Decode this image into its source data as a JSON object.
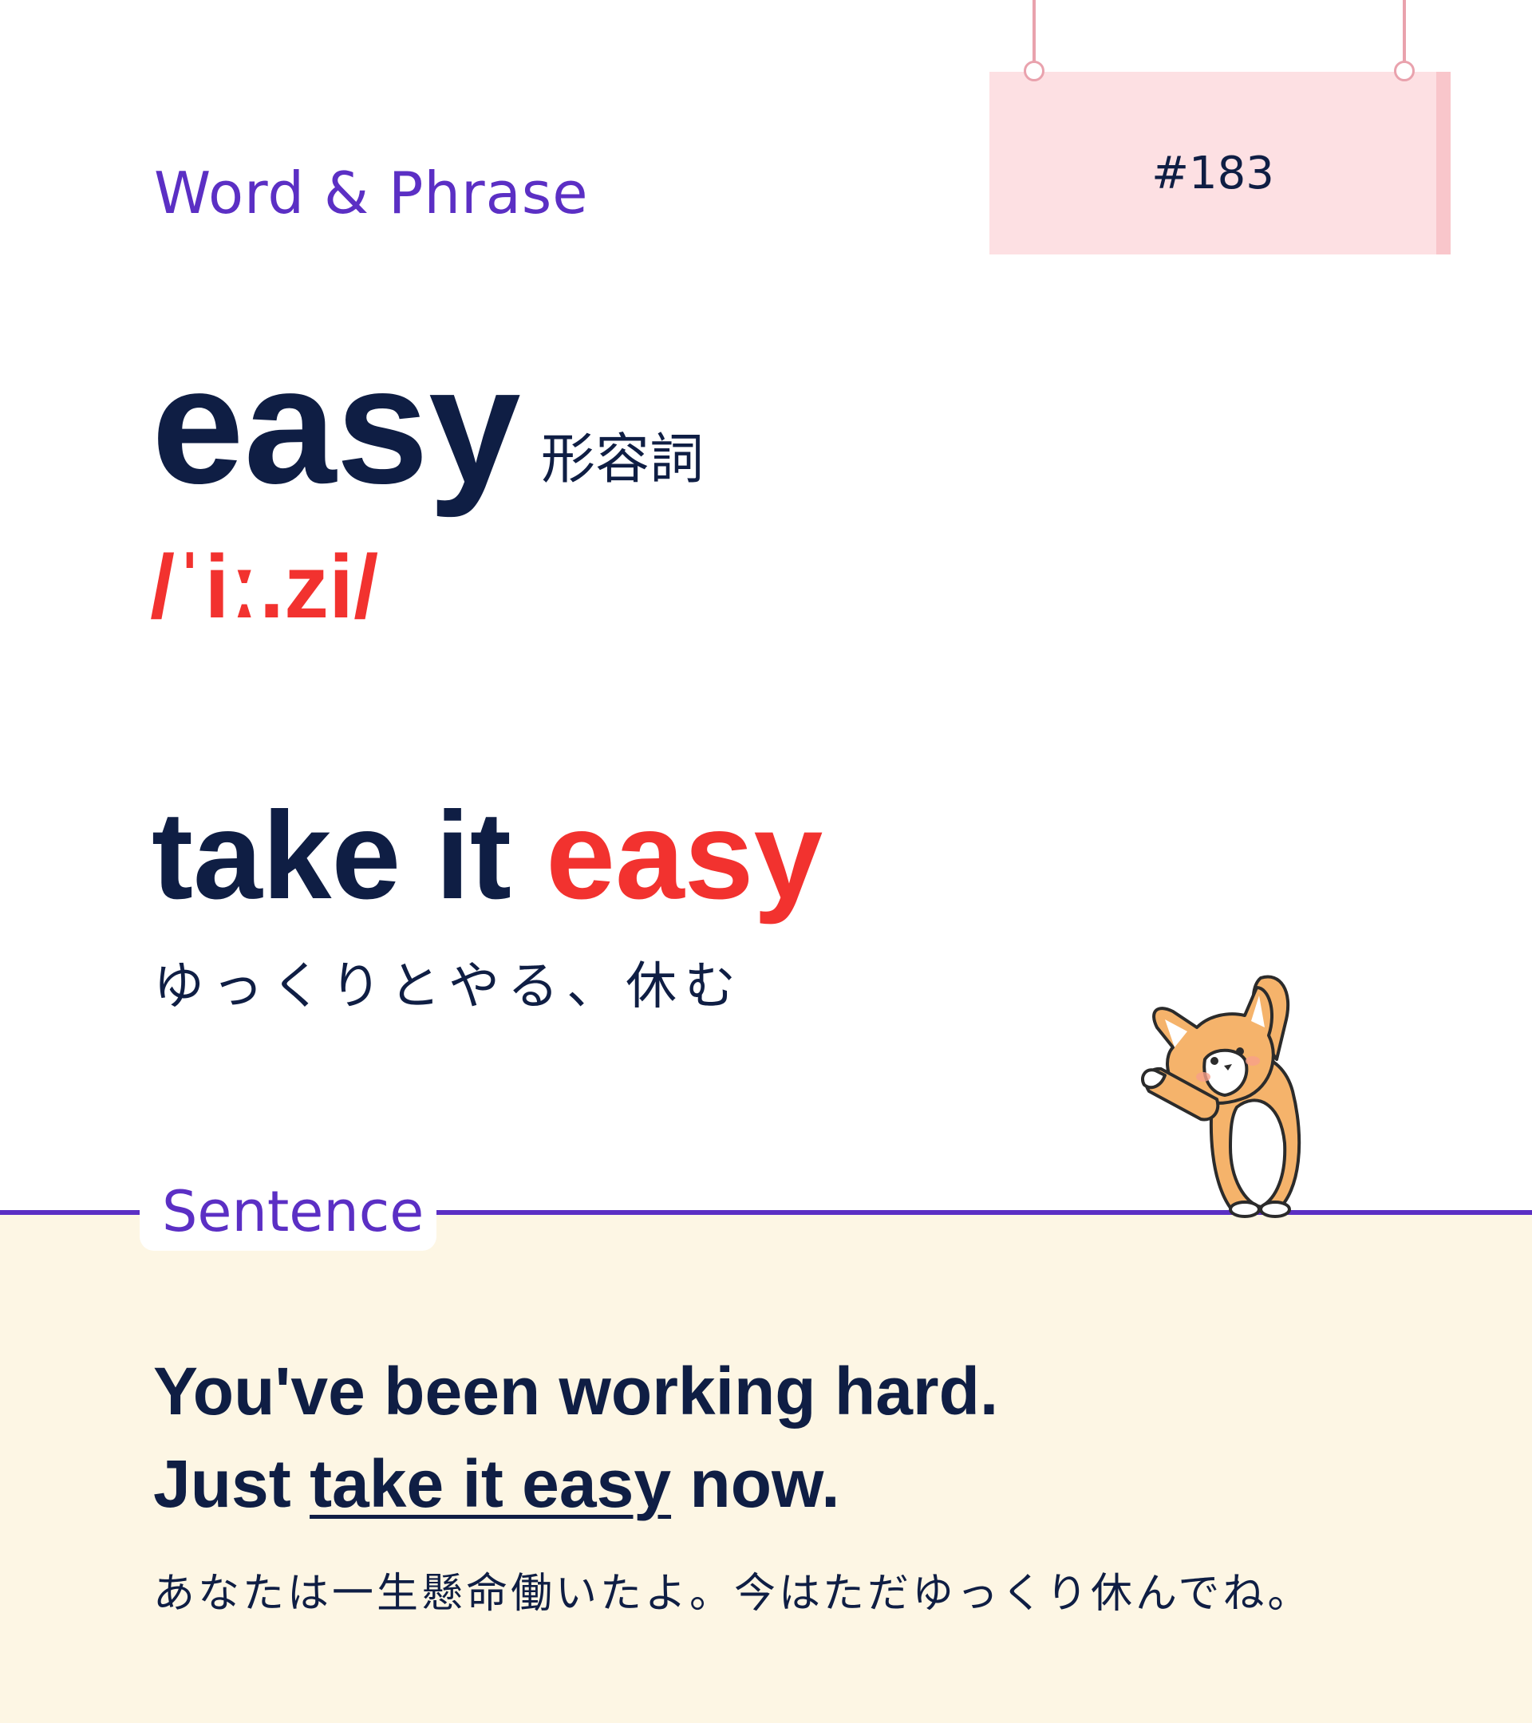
{
  "header": {
    "section_label": "Word & Phrase",
    "card_number": "#183"
  },
  "word": {
    "term": "easy",
    "part_of_speech": "形容詞",
    "pronunciation": "/ˈiː.zi/"
  },
  "phrase": {
    "prefix": "take it ",
    "highlight": "easy",
    "meaning": "ゆっくりとやる、休む"
  },
  "sentence": {
    "label": "Sentence",
    "line1": "You've been working hard.",
    "line2_before": "Just ",
    "line2_underlined": "take it easy",
    "line2_after": " now.",
    "translation": "あなたは一生懸命働いたよ。今はただゆっくり休んでね。"
  },
  "colors": {
    "accent_purple": "#5b2fc4",
    "accent_red": "#f2322f",
    "text_navy": "#0f1e44",
    "sign_pink": "#fde0e3",
    "cream_bg": "#fdf6e4"
  },
  "illustration": {
    "icon": "corgi-stretching-icon"
  }
}
